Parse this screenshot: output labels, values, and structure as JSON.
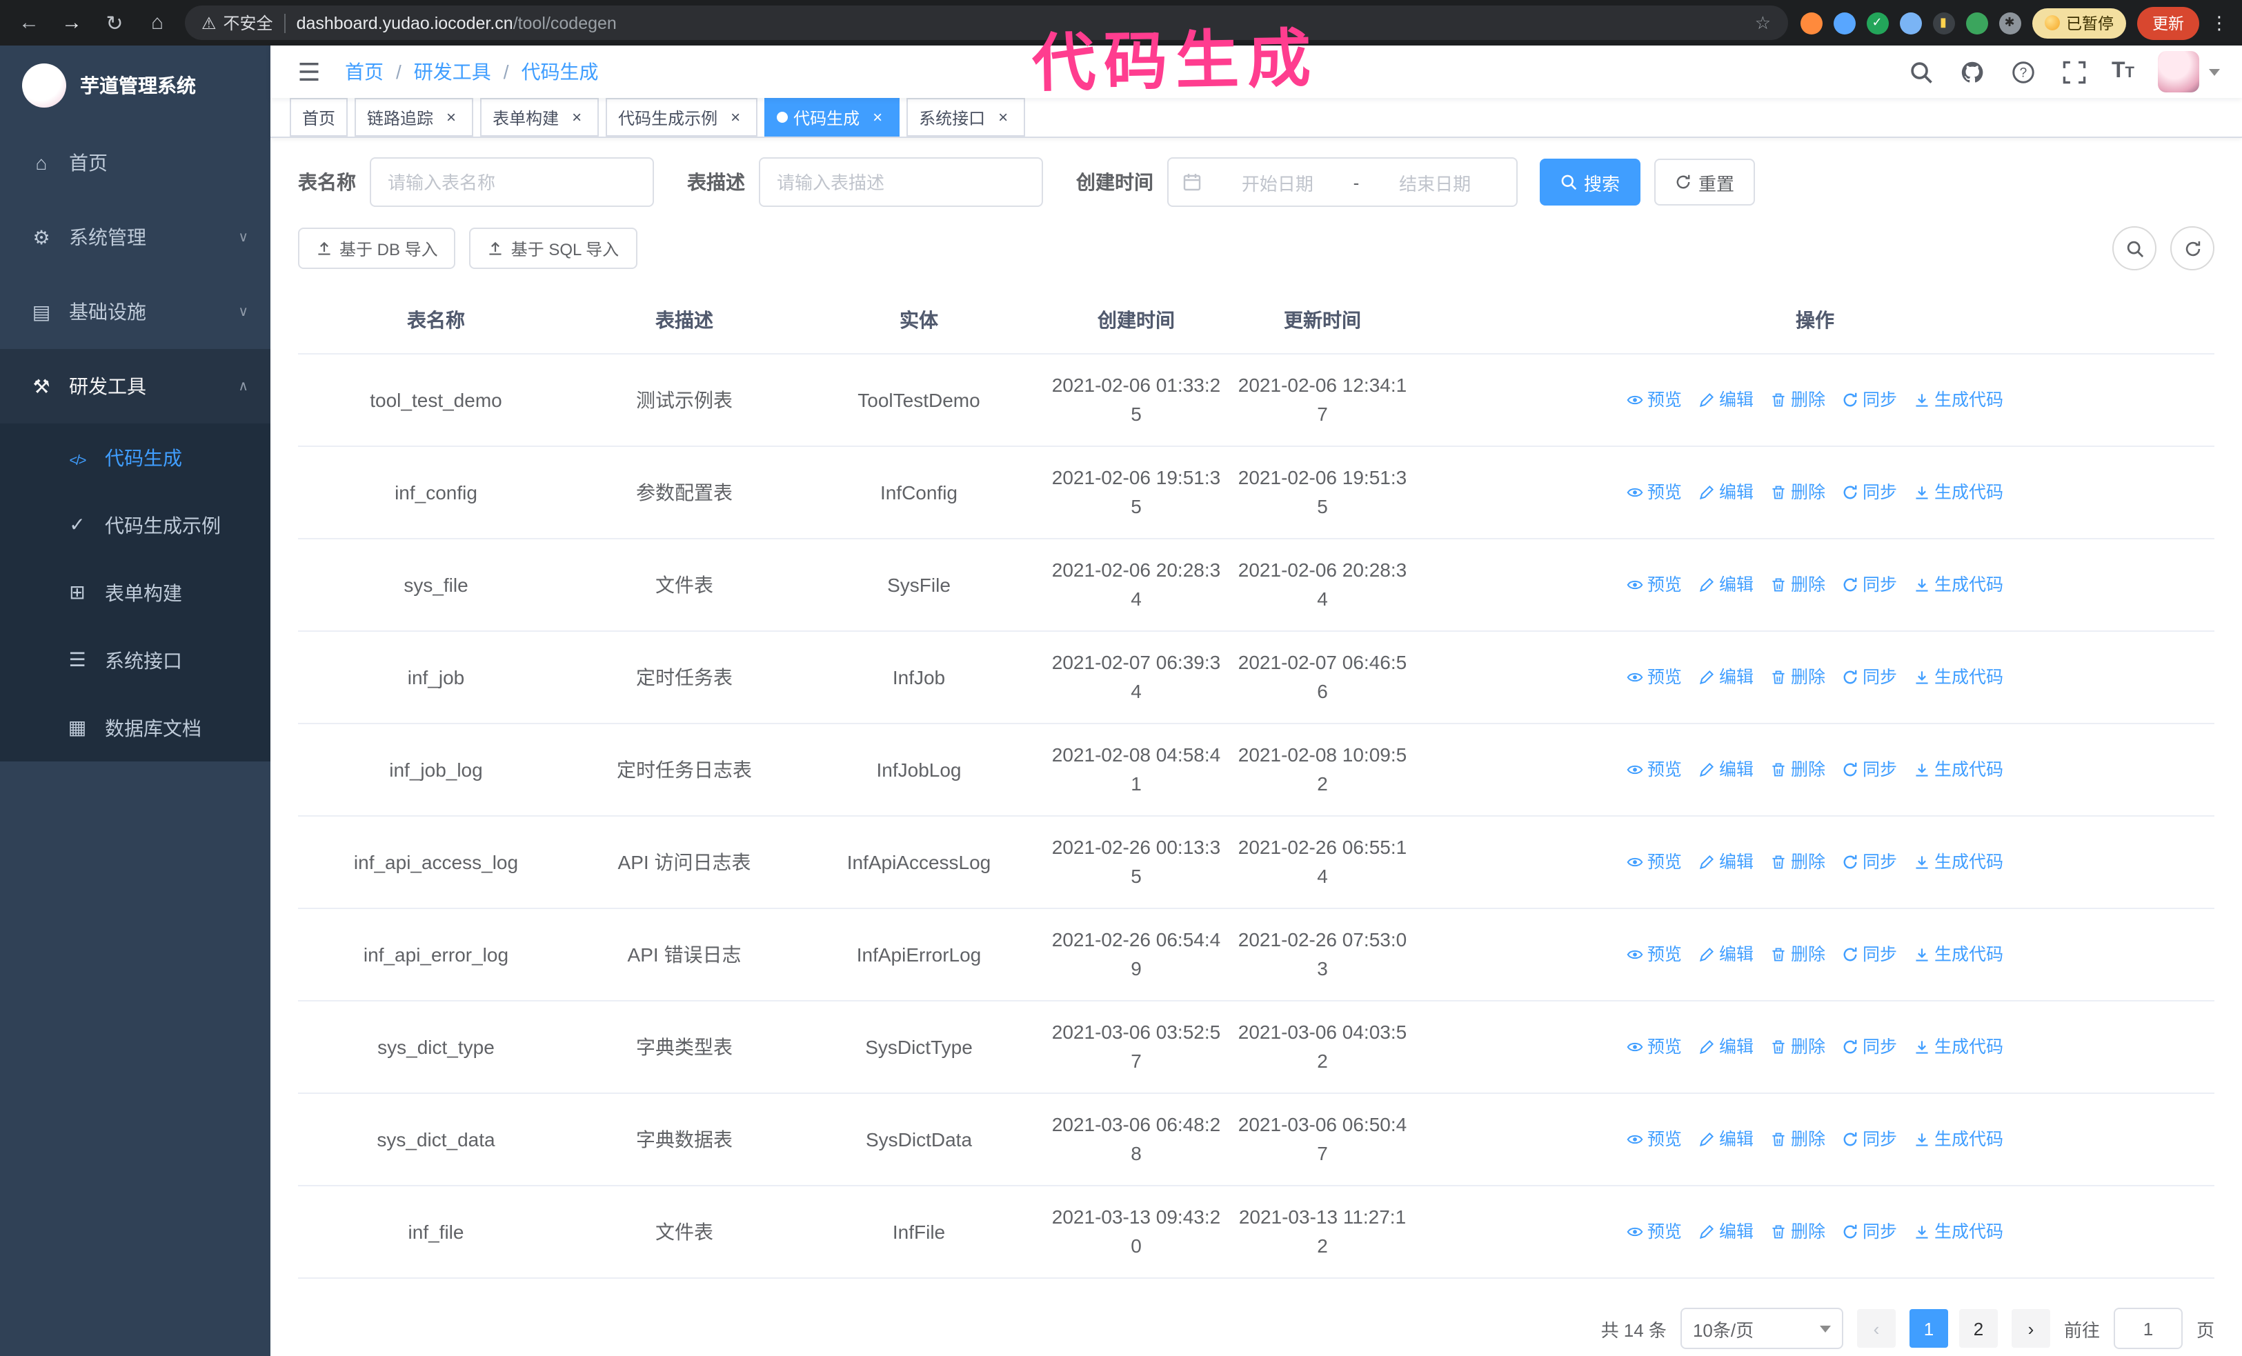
{
  "browser": {
    "security_label": "不安全",
    "url_host": "dashboard.yudao.iocoder.cn",
    "url_path": "/tool/codegen",
    "paused_badge": "已暂停",
    "update_button": "更新"
  },
  "annotation": "代码生成",
  "sidebar": {
    "logo_title": "芋道管理系统",
    "items": [
      {
        "label": "首页",
        "icon": "home",
        "level": "1"
      },
      {
        "label": "系统管理",
        "icon": "gear",
        "level": "1",
        "chevron": "down"
      },
      {
        "label": "基础设施",
        "icon": "infra",
        "level": "1",
        "chevron": "down"
      },
      {
        "label": "研发工具",
        "icon": "tools",
        "level": "1",
        "chevron": "up",
        "open": true
      },
      {
        "label": "代码生成",
        "icon": "code",
        "level": "2",
        "active": true
      },
      {
        "label": "代码生成示例",
        "icon": "example",
        "level": "2"
      },
      {
        "label": "表单构建",
        "icon": "form",
        "level": "2"
      },
      {
        "label": "系统接口",
        "icon": "api",
        "level": "2"
      },
      {
        "label": "数据库文档",
        "icon": "db",
        "level": "2"
      }
    ]
  },
  "navbar": {
    "breadcrumb": [
      {
        "label": "首页"
      },
      {
        "label": "研发工具"
      },
      {
        "label": "代码生成"
      }
    ]
  },
  "tabs": [
    {
      "label": "首页",
      "closable": false
    },
    {
      "label": "链路追踪",
      "closable": true
    },
    {
      "label": "表单构建",
      "closable": true
    },
    {
      "label": "代码生成示例",
      "closable": true
    },
    {
      "label": "代码生成",
      "closable": true,
      "active": true
    },
    {
      "label": "系统接口",
      "closable": true
    }
  ],
  "filters": {
    "table_name_label": "表名称",
    "table_name_placeholder": "请输入表名称",
    "table_desc_label": "表描述",
    "table_desc_placeholder": "请输入表描述",
    "create_time_label": "创建时间",
    "date_start_placeholder": "开始日期",
    "date_separator": "-",
    "date_end_placeholder": "结束日期",
    "search_label": "搜索",
    "reset_label": "重置"
  },
  "toolbar": {
    "import_db_label": "基于 DB 导入",
    "import_sql_label": "基于 SQL 导入"
  },
  "table": {
    "headers": [
      "表名称",
      "表描述",
      "实体",
      "创建时间",
      "更新时间",
      "操作"
    ],
    "ops": [
      {
        "label": "预览"
      },
      {
        "label": "编辑"
      },
      {
        "label": "删除"
      },
      {
        "label": "同步"
      },
      {
        "label": "生成代码"
      }
    ],
    "rows": [
      {
        "name": "tool_test_demo",
        "desc": "测试示例表",
        "entity": "ToolTestDemo",
        "created": "2021-02-06 01:33:25",
        "updated": "2021-02-06 12:34:17"
      },
      {
        "name": "inf_config",
        "desc": "参数配置表",
        "entity": "InfConfig",
        "created": "2021-02-06 19:51:35",
        "updated": "2021-02-06 19:51:35"
      },
      {
        "name": "sys_file",
        "desc": "文件表",
        "entity": "SysFile",
        "created": "2021-02-06 20:28:34",
        "updated": "2021-02-06 20:28:34"
      },
      {
        "name": "inf_job",
        "desc": "定时任务表",
        "entity": "InfJob",
        "created": "2021-02-07 06:39:34",
        "updated": "2021-02-07 06:46:56"
      },
      {
        "name": "inf_job_log",
        "desc": "定时任务日志表",
        "entity": "InfJobLog",
        "created": "2021-02-08 04:58:41",
        "updated": "2021-02-08 10:09:52"
      },
      {
        "name": "inf_api_access_log",
        "desc": "API 访问日志表",
        "entity": "InfApiAccessLog",
        "created": "2021-02-26 00:13:35",
        "updated": "2021-02-26 06:55:14"
      },
      {
        "name": "inf_api_error_log",
        "desc": "API 错误日志",
        "entity": "InfApiErrorLog",
        "created": "2021-02-26 06:54:49",
        "updated": "2021-02-26 07:53:03"
      },
      {
        "name": "sys_dict_type",
        "desc": "字典类型表",
        "entity": "SysDictType",
        "created": "2021-03-06 03:52:57",
        "updated": "2021-03-06 04:03:52"
      },
      {
        "name": "sys_dict_data",
        "desc": "字典数据表",
        "entity": "SysDictData",
        "created": "2021-03-06 06:48:28",
        "updated": "2021-03-06 06:50:47"
      },
      {
        "name": "inf_file",
        "desc": "文件表",
        "entity": "InfFile",
        "created": "2021-03-13 09:43:20",
        "updated": "2021-03-13 11:27:12"
      }
    ]
  },
  "pagination": {
    "total": "共 14 条",
    "page_size": "10条/页",
    "pages": [
      {
        "label": "1",
        "active": true
      },
      {
        "label": "2"
      }
    ],
    "goto_label": "前往",
    "goto_value": "1",
    "page_unit": "页"
  },
  "colors": {
    "primary": "#409EFF",
    "sidebar_bg": "#304156",
    "submenu_bg": "#1F2D3D",
    "active_tab_bg": "#409EFF",
    "annotation": "#FF3D8F",
    "update_button_bg": "#D8472F"
  }
}
